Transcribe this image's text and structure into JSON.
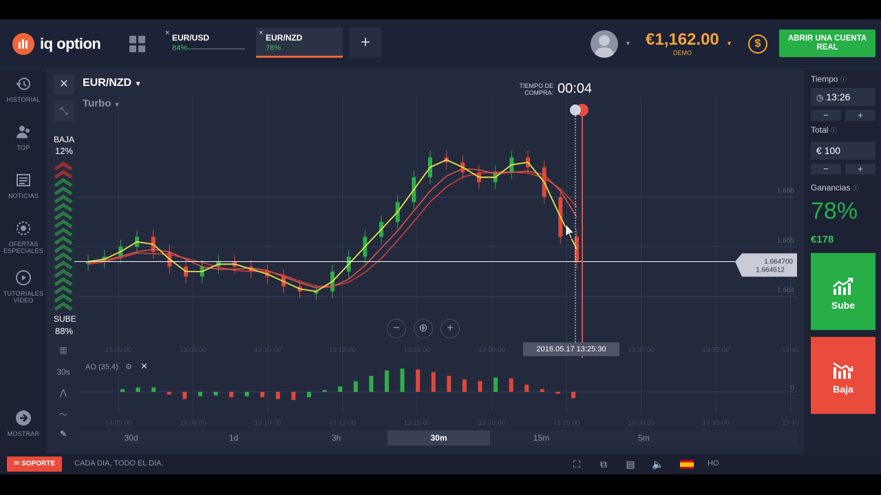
{
  "header": {
    "logo_text": "iq option",
    "tabs": [
      {
        "name": "EUR/USD",
        "pct": "84%",
        "close": "×"
      },
      {
        "name": "EUR/NZD",
        "pct": "78%",
        "close": "×"
      }
    ],
    "add_tab": "+",
    "balance": "€1,162.00",
    "balance_mode": "DEMO",
    "real_account_button": "ABRIR UNA CUENTA REAL"
  },
  "sidebar": {
    "items": [
      {
        "label": "HISTORIAL",
        "icon": "history-icon"
      },
      {
        "label": "TOP",
        "icon": "users-icon"
      },
      {
        "label": "NOTICIAS",
        "icon": "news-icon"
      },
      {
        "label": "OFERTAS ESPECIALES",
        "icon": "offers-icon"
      },
      {
        "label": "TUTORIALES VÍDEO",
        "icon": "play-icon"
      }
    ],
    "show_label": "MOSTRAR"
  },
  "chart": {
    "pair": "EUR/NZD",
    "mode": "Turbo",
    "purchase_label": "TIEMPO DE COMPRA:",
    "purchase_time": "00:04",
    "sentiment_low_label": "BAJA",
    "sentiment_low_pct": "12%",
    "sentiment_high_label": "SUBE",
    "sentiment_high_pct": "88%",
    "price_levels": [
      "1.666",
      "1.665",
      "1.664"
    ],
    "current_price": "1.664700",
    "prev_price": "1.664612",
    "time_badge": "2016.05.17 13:25:30",
    "time_ticks": [
      "13:05:00",
      "13:08:00",
      "13:10:00",
      "13:13:00",
      "13:15:00",
      "13:20:00",
      "13:25:00",
      "13:30:00",
      "13:35:00",
      "13:40"
    ],
    "zoom_out": "−",
    "zoom_center": "⊕",
    "zoom_in": "+",
    "indicator_label": "AO (35,4)",
    "indicator_zero": "0",
    "candle_period": "30s",
    "timeframes": [
      "30d",
      "1d",
      "3h",
      "30m",
      "15m",
      "5m"
    ],
    "active_timeframe": "30m"
  },
  "chart_data": {
    "type": "candlestick",
    "pair": "EUR/NZD",
    "ylim": [
      1.6636,
      1.6672
    ],
    "current_price": 1.6647,
    "series": [
      {
        "name": "price",
        "values": [
          1.6647,
          1.6648,
          1.665,
          1.6652,
          1.6649,
          1.6646,
          1.6644,
          1.6646,
          1.6647,
          1.6646,
          1.6645,
          1.6644,
          1.6642,
          1.6641,
          1.6641,
          1.6645,
          1.6648,
          1.6652,
          1.6655,
          1.6659,
          1.6664,
          1.6668,
          1.6667,
          1.6665,
          1.6663,
          1.6665,
          1.6668,
          1.6666,
          1.666,
          1.6652,
          1.6647
        ]
      }
    ],
    "indicator": {
      "name": "AO (35,4)",
      "values": [
        0.3,
        0.5,
        0.5,
        -0.3,
        -0.8,
        -0.5,
        -0.4,
        -0.6,
        -0.5,
        -0.6,
        -0.8,
        -0.9,
        -0.6,
        0.2,
        0.6,
        1.2,
        1.8,
        2.4,
        2.6,
        2.5,
        2.2,
        1.8,
        1.4,
        1.2,
        1.6,
        1.5,
        0.8,
        0.3,
        -0.2,
        -0.7
      ]
    }
  },
  "rpanel": {
    "time_label": "Tiempo",
    "time_value": "13:26",
    "total_label": "Total",
    "total_value": "€ 100",
    "minus": "−",
    "plus": "+",
    "profit_label": "Ganancias",
    "profit_pct": "78%",
    "profit_amount": "€178",
    "up_label": "Sube",
    "down_label": "Baja"
  },
  "footer": {
    "support": "SOPORTE",
    "ticker": "CADA DIA, TODO EL DIA.",
    "hours": "HO"
  },
  "colors": {
    "background": "#1c2234",
    "accent": "#f0663a",
    "green": "#27ae47",
    "red": "#e94b3c",
    "balance": "#f6a23b"
  }
}
